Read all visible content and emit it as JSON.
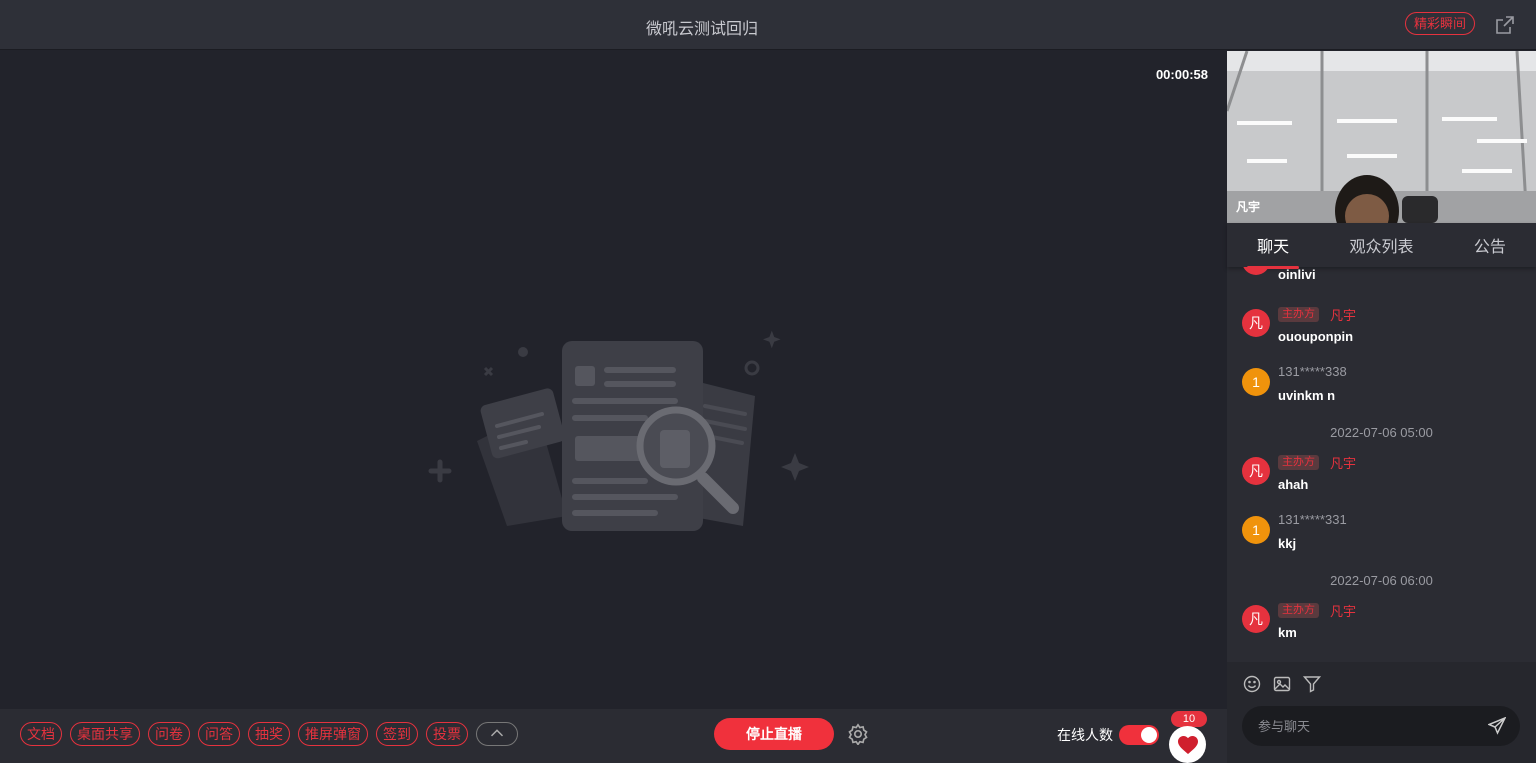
{
  "header": {
    "title": "微吼云测试回归",
    "highlight_label": "精彩瞬间"
  },
  "stage": {
    "timer": "00:00:58"
  },
  "toolbar": {
    "tools": [
      "文档",
      "桌面共享",
      "问卷",
      "问答",
      "抽奖",
      "推屏弹窗",
      "签到",
      "投票"
    ],
    "stop_label": "停止直播",
    "online_label": "在线人数",
    "like_count": "10"
  },
  "video": {
    "name": "凡宇"
  },
  "tabs": [
    "聊天",
    "观众列表",
    "公告"
  ],
  "chat": {
    "messages": [
      {
        "avatar": "",
        "role": "",
        "name": "",
        "text": "oinlivi"
      },
      {
        "avatar": "凡",
        "role": "主办方",
        "name": "凡宇",
        "text": "ououponpin"
      },
      {
        "avatar": "1",
        "role": "",
        "name": "131*****338",
        "text": "uvinkm n"
      },
      {
        "avatar": "凡",
        "role": "主办方",
        "name": "凡宇",
        "text": "ahah"
      },
      {
        "avatar": "1",
        "role": "",
        "name": "131*****331",
        "text": "kkj"
      },
      {
        "avatar": "凡",
        "role": "主办方",
        "name": "凡宇",
        "text": "km"
      }
    ],
    "times": [
      "2022-07-06 05:00",
      "2022-07-06 06:00"
    ]
  },
  "input": {
    "placeholder": "参与聊天"
  },
  "colors": {
    "accent": "#e5323e",
    "host_avatar": "#e5323e",
    "user_avatar": "#f0930c"
  },
  "icons": [
    "share-icon",
    "chevron-up-icon",
    "gear-icon",
    "heart-icon",
    "emoji-icon",
    "image-icon",
    "filter-icon",
    "send-icon"
  ]
}
